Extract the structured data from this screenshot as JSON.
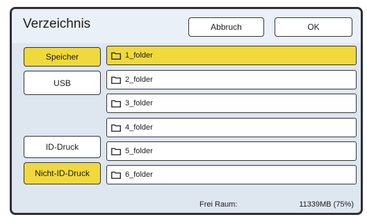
{
  "header": {
    "title": "Verzeichnis",
    "cancel_label": "Abbruch",
    "ok_label": "OK"
  },
  "sidebar": {
    "items": [
      {
        "label": "Speicher",
        "selected": true
      },
      {
        "label": "USB",
        "selected": false
      },
      {
        "label": "ID-Druck",
        "selected": false
      },
      {
        "label": "Nicht-ID-Druck",
        "selected": true
      }
    ]
  },
  "folders": [
    {
      "name": "1_folder",
      "selected": true,
      "icon": "folder-icon"
    },
    {
      "name": "2_folder",
      "selected": false,
      "icon": "folder-icon"
    },
    {
      "name": "3_folder",
      "selected": false,
      "icon": "folder-icon"
    },
    {
      "name": "4_folder",
      "selected": false,
      "icon": "folder-icon"
    },
    {
      "name": "5_folder",
      "selected": false,
      "icon": "folder-icon"
    },
    {
      "name": "6_folder",
      "selected": false,
      "icon": "folder-icon"
    }
  ],
  "footer": {
    "free_space_label": "Frei Raum:",
    "free_space_value": "11339MB (75%)"
  },
  "colors": {
    "accent_yellow": "#f0d93c",
    "panel_bg": "#dee6f0",
    "header_bg": "#eaf0f7"
  }
}
